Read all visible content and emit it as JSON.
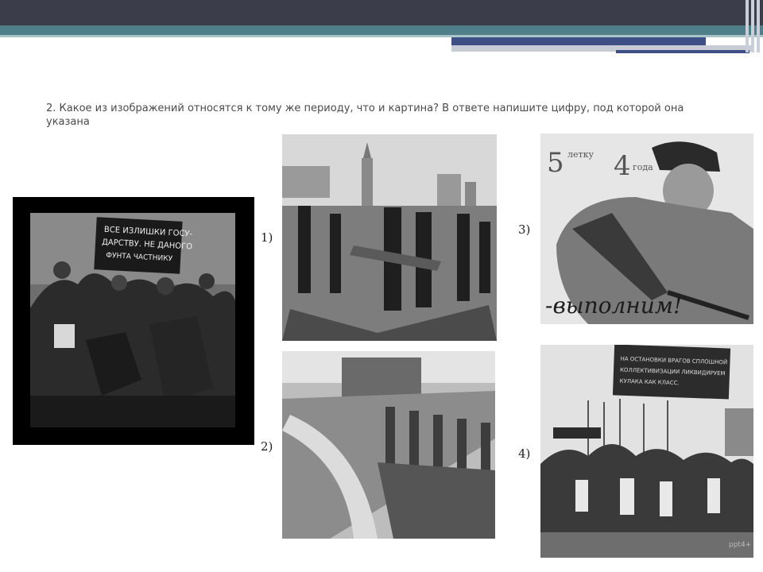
{
  "question": {
    "text": "2. Какое из изображений относятся к тому же периоду, что и картина? В ответе напишите цифру, под которой она указана"
  },
  "main_image": {
    "banner_text": "ВСЕ ИЗЛИШКИ ГОСУ-ДАРСТВУ, НЕ ДАННОГО ФУНТА ЧАСТНИКУ"
  },
  "options": [
    {
      "label": "1)"
    },
    {
      "label": "2)"
    },
    {
      "label": "3)",
      "poster_text_top": "5 летку в 4 года",
      "poster_text_bottom": "-выполним!"
    },
    {
      "label": "4)",
      "banner_text": "НА ОСТАНОВКИ ВРАГОВ СПЛОШНОЙ КОЛЛЕКТИВИЗАЦИИ ЛИКВИДИРУЕМ КУЛАКА КАК КЛАСС."
    }
  ],
  "watermark": "ppt4+"
}
